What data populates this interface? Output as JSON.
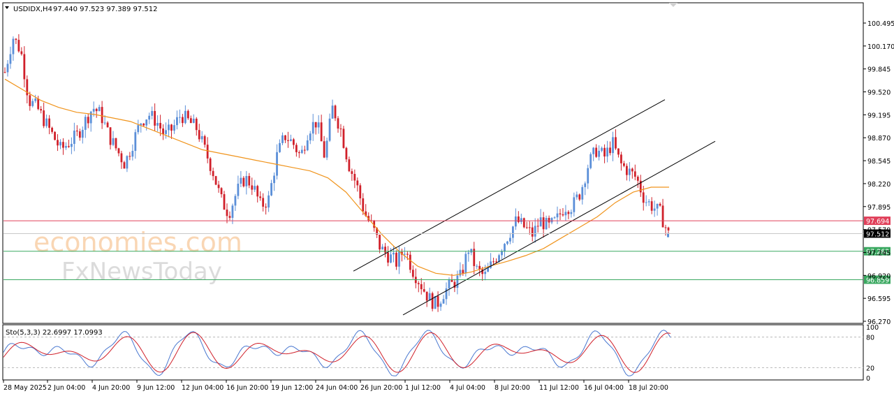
{
  "chart_data": [
    {
      "type": "candlestick",
      "symbol_header": "USDIDX,H4",
      "ohlc_header": "97.440 97.523 97.389 97.512",
      "ylim": [
        96.27,
        100.57
      ],
      "y_ticks": [
        "100.495",
        "100.170",
        "99.845",
        "99.520",
        "99.195",
        "98.870",
        "98.545",
        "98.220",
        "97.895",
        "97.570",
        "97.245",
        "96.920",
        "96.595",
        "96.270"
      ],
      "x_ticks": [
        "28 May 2025",
        "2 Jun 04:00",
        "4 Jun 20:00",
        "9 Jun 12:00",
        "12 Jun 04:00",
        "16 Jun 20:00",
        "19 Jun 12:00",
        "24 Jun 04:00",
        "26 Jun 20:00",
        "1 Jul 12:00",
        "4 Jul 04:00",
        "8 Jul 20:00",
        "11 Jul 12:00",
        "16 Jul 04:00",
        "18 Jul 20:00"
      ],
      "price_levels": [
        {
          "label": "97.694",
          "value": 97.694,
          "color": "#e0405a"
        },
        {
          "label": "97.512",
          "value": 97.512,
          "color": "#000000"
        },
        {
          "label": "97.262",
          "value": 97.262,
          "color": "#3aa860"
        },
        {
          "label": "96.859",
          "value": 96.859,
          "color": "#3aa860"
        }
      ],
      "close_path": [
        99.8,
        100.3,
        100.1,
        99.4,
        99.3,
        99.1,
        98.9,
        98.7,
        98.8,
        98.9,
        99.1,
        99.3,
        99.2,
        98.9,
        98.7,
        98.5,
        98.8,
        99.1,
        99.2,
        99.1,
        98.9,
        99.0,
        99.2,
        99.1,
        99.0,
        98.7,
        98.4,
        98.0,
        97.8,
        98.1,
        98.3,
        98.2,
        97.9,
        98.0,
        98.6,
        98.9,
        98.8,
        98.6,
        99.0,
        99.1,
        98.6,
        99.3,
        99.0,
        98.5,
        98.2,
        97.8,
        97.6,
        97.3,
        97.2,
        97.1,
        97.3,
        97.0,
        96.8,
        96.6,
        96.5,
        96.7,
        96.8,
        96.9,
        97.3,
        97.0,
        96.9,
        97.1,
        97.3,
        97.5,
        97.7,
        97.6,
        97.5,
        97.7,
        97.6,
        97.7,
        97.9,
        97.9,
        98.1,
        98.5,
        98.7,
        98.6,
        98.8,
        98.5,
        98.4,
        98.3,
        98.0,
        97.9,
        97.8,
        97.5
      ],
      "ma_label": "",
      "ma_path": [
        99.7,
        99.55,
        99.4,
        99.3,
        99.23,
        99.2,
        99.15,
        99.1,
        99.0,
        98.9,
        98.8,
        98.7,
        98.65,
        98.6,
        98.55,
        98.5,
        98.45,
        98.4,
        98.3,
        98.1,
        97.8,
        97.5,
        97.25,
        97.05,
        96.95,
        96.92,
        96.97,
        97.05,
        97.12,
        97.2,
        97.3,
        97.45,
        97.6,
        97.75,
        97.95,
        98.1,
        98.17,
        98.17
      ],
      "channel": {
        "upper": [
          [
            96.98,
            0.505
          ],
          [
            99.41,
            0.952
          ]
        ],
        "lower": [
          [
            96.36,
            0.577
          ],
          [
            98.82,
            1.0
          ]
        ]
      },
      "oscillator": {
        "label": "Sto(5,3,3) 22.6997 17.0993",
        "ylim": [
          0,
          100
        ],
        "ticks": [
          "100",
          "80",
          "20",
          "0"
        ],
        "main_color": "#4a78d0",
        "signal_color": "#d0202a"
      },
      "watermark": {
        "line1": "economies.com",
        "line2": "FxNewsToday"
      }
    }
  ]
}
